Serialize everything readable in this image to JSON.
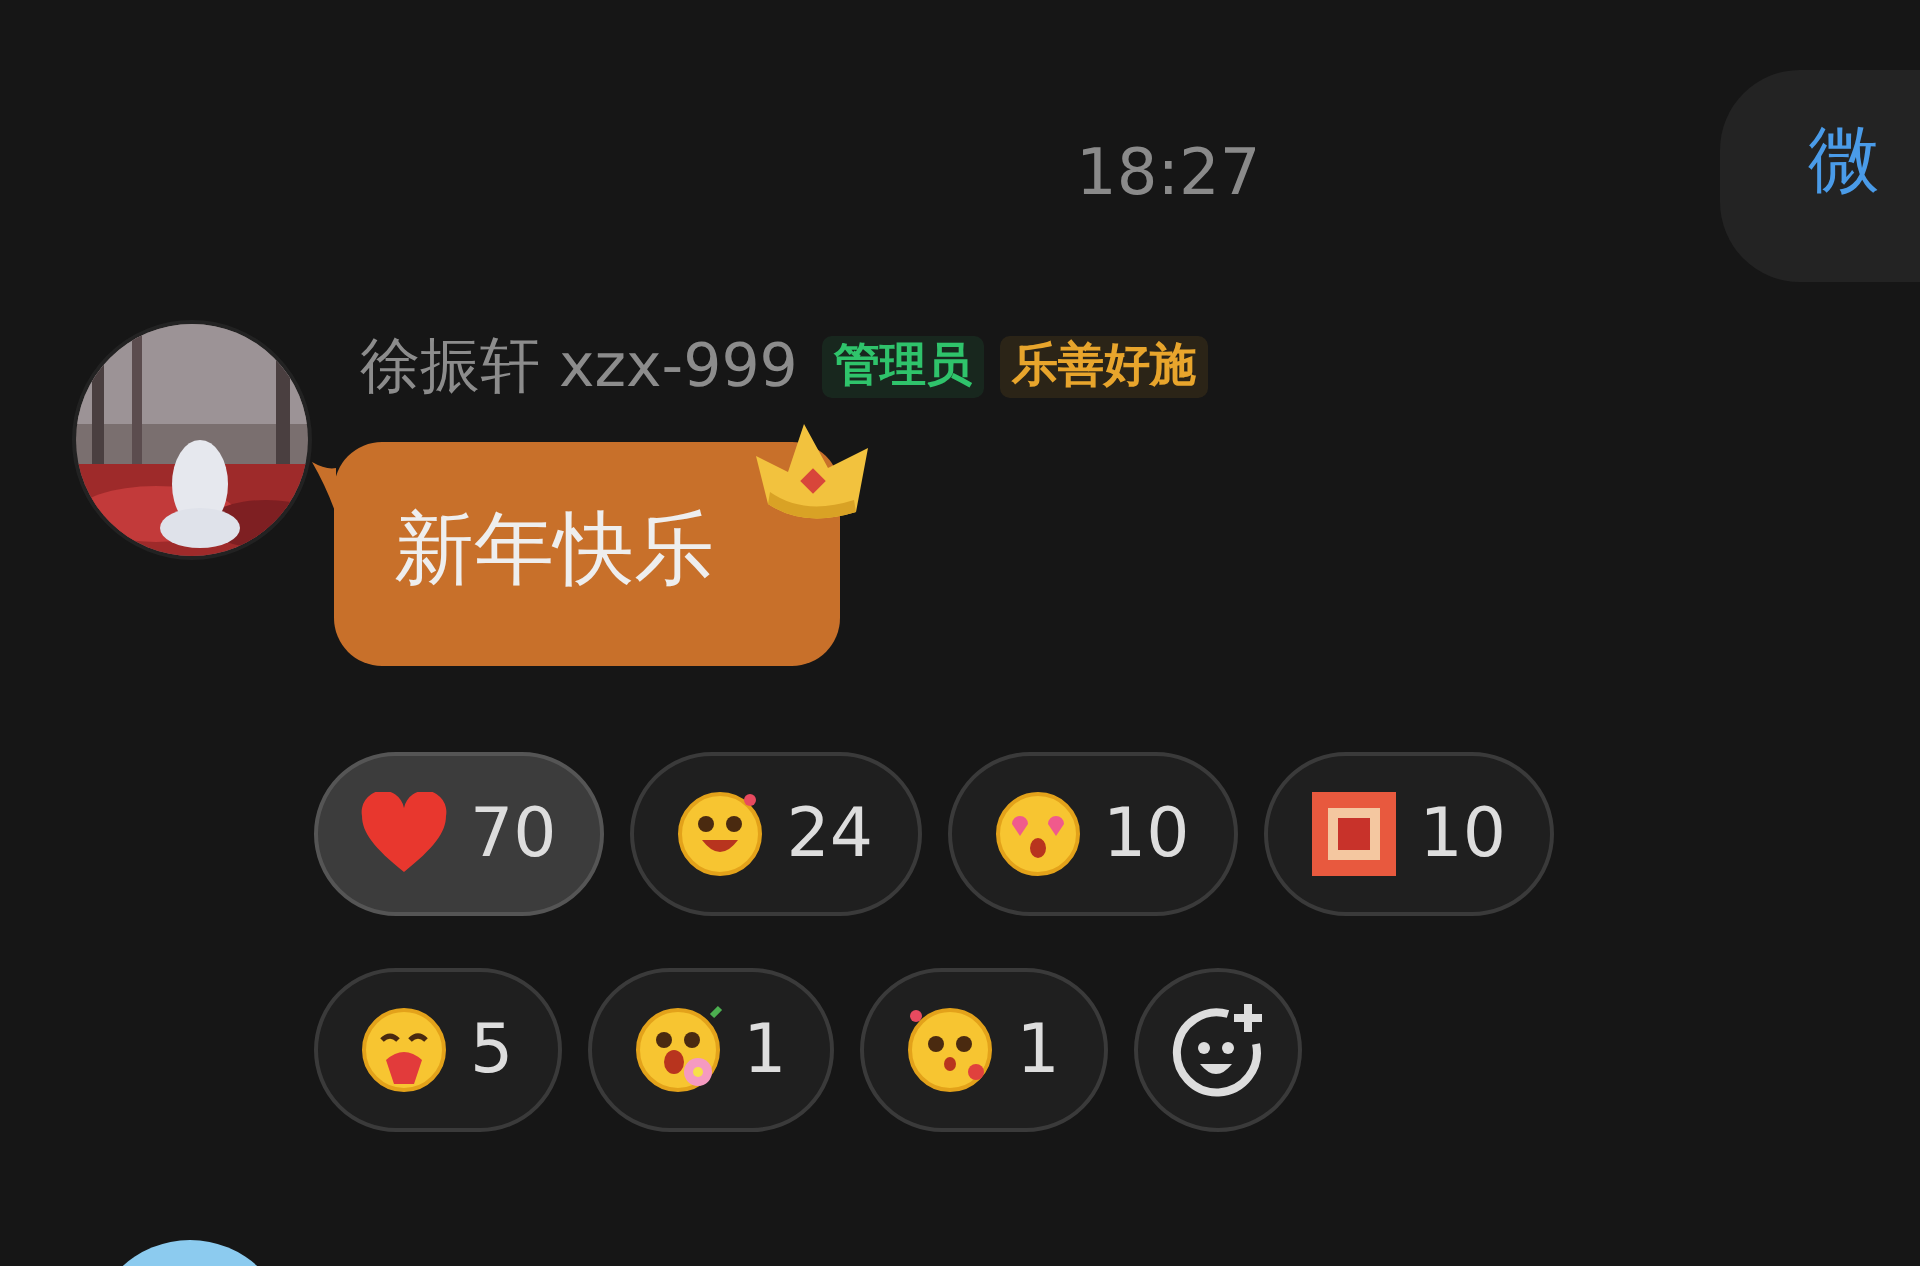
{
  "header": {
    "time": "18:27",
    "peek_bubble": "微"
  },
  "message": {
    "sender": "徐振轩 xzx-999",
    "badges": [
      {
        "label": "管理员",
        "color": "#2fc36b"
      },
      {
        "label": "乐善好施",
        "color": "#e8a52c"
      }
    ],
    "text": "新年快乐",
    "reactions": [
      {
        "count": "70",
        "selected": true
      },
      {
        "count": "24",
        "selected": false
      },
      {
        "count": "10",
        "selected": false
      },
      {
        "count": "10",
        "selected": false
      },
      {
        "count": "5",
        "selected": false
      },
      {
        "count": "1",
        "selected": false
      },
      {
        "count": "1",
        "selected": false
      }
    ]
  }
}
